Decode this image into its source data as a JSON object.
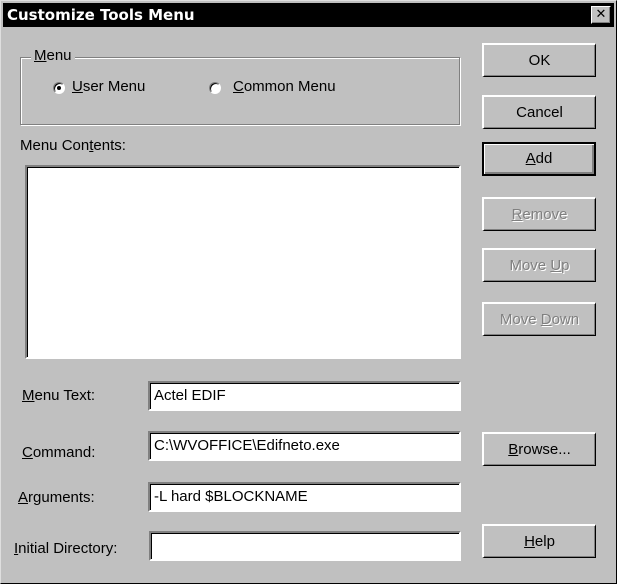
{
  "window": {
    "title": "Customize Tools Menu",
    "close_symbol": "✕"
  },
  "menu_group": {
    "legend_u": "M",
    "legend_rest": "enu",
    "user_u": "U",
    "user_rest": "ser Menu",
    "common_u": "C",
    "common_rest": "ommon Menu",
    "selected": "User Menu"
  },
  "menu_contents": {
    "label_a": "Menu Con",
    "label_u": "t",
    "label_b": "ents:",
    "items": []
  },
  "fields": {
    "menu_text_u": "M",
    "menu_text_rest": "enu Text:",
    "menu_text_value": "Actel EDIF",
    "command_u": "C",
    "command_rest": "ommand:",
    "command_value": "C:\\WVOFFICE\\Edifneto.exe",
    "arguments_u": "A",
    "arguments_rest": "rguments:",
    "arguments_value": "-L hard $BLOCKNAME",
    "initdir_u": "I",
    "initdir_rest": "nitial Directory:",
    "initdir_value": ""
  },
  "buttons": {
    "ok": "OK",
    "cancel": "Cancel",
    "add_u": "A",
    "add_rest": "dd",
    "remove_u": "R",
    "remove_rest": "emove",
    "moveup_a": "Move ",
    "moveup_u": "U",
    "moveup_b": "p",
    "movedown_a": "Move ",
    "movedown_u": "D",
    "movedown_b": "own",
    "browse_u": "B",
    "browse_rest": "rowse...",
    "help_u": "H",
    "help_rest": "elp"
  }
}
